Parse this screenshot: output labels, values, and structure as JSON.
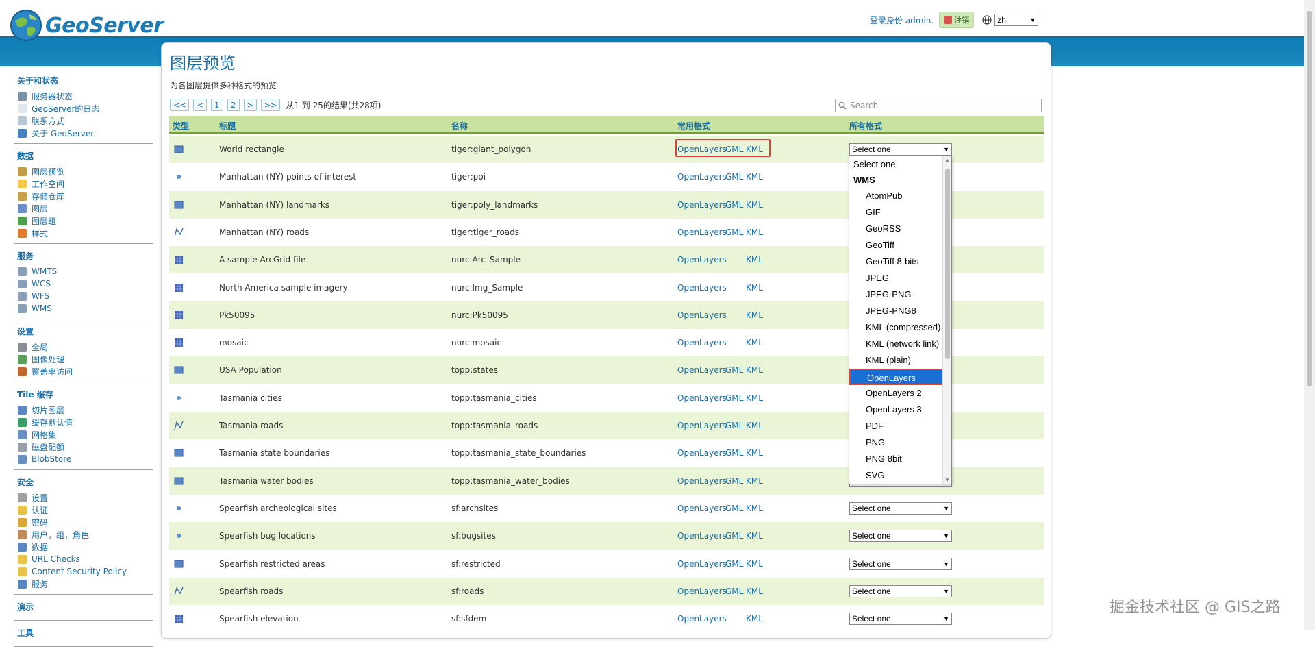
{
  "header": {
    "app_name": "GeoServer",
    "login_text": "登录身份 admin.",
    "logout_label": "注销",
    "lang_value": "zh"
  },
  "sidebar": {
    "sections": [
      {
        "title": "关于和状态",
        "items": [
          {
            "label": "服务器状态",
            "icon": "server-status-icon",
            "color": "#7a8fa8"
          },
          {
            "label": "GeoServer的日志",
            "icon": "log-icon",
            "color": "#dfe6ee"
          },
          {
            "label": "联系方式",
            "icon": "contact-icon",
            "color": "#b9c6d3"
          },
          {
            "label": "关于 GeoServer",
            "icon": "info-icon",
            "color": "#4a7fc0"
          }
        ]
      },
      {
        "title": "数据",
        "items": [
          {
            "label": "图层预览",
            "icon": "layer-preview-icon",
            "color": "#c59d4a"
          },
          {
            "label": "工作空间",
            "icon": "folder-icon",
            "color": "#f2c94c"
          },
          {
            "label": "存储仓库",
            "icon": "store-icon",
            "color": "#c9a04a"
          },
          {
            "label": "图层",
            "icon": "layer-icon",
            "color": "#6b8fc7"
          },
          {
            "label": "图层组",
            "icon": "layer-group-icon",
            "color": "#4ca04a"
          },
          {
            "label": "样式",
            "icon": "style-icon",
            "color": "#e07a2e"
          }
        ]
      },
      {
        "title": "服务",
        "items": [
          {
            "label": "WMTS",
            "icon": "wmts-icon",
            "color": "#8aa0b8"
          },
          {
            "label": "WCS",
            "icon": "wcs-icon",
            "color": "#8aa0b8"
          },
          {
            "label": "WFS",
            "icon": "wfs-icon",
            "color": "#8aa0b8"
          },
          {
            "label": "WMS",
            "icon": "wms-icon",
            "color": "#8aa0b8"
          }
        ]
      },
      {
        "title": "设置",
        "items": [
          {
            "label": "全局",
            "icon": "global-settings-icon",
            "color": "#8a8f96"
          },
          {
            "label": "图像处理",
            "icon": "image-processing-icon",
            "color": "#5aa05a"
          },
          {
            "label": "覆盖率访问",
            "icon": "coverage-access-icon",
            "color": "#c0672e"
          }
        ]
      },
      {
        "title": "Tile 缓存",
        "items": [
          {
            "label": "切片图层",
            "icon": "tile-layers-icon",
            "color": "#5b86c4"
          },
          {
            "label": "缓存默认值",
            "icon": "cache-defaults-icon",
            "color": "#3aa06a"
          },
          {
            "label": "网格集",
            "icon": "gridset-icon",
            "color": "#6a8fc0"
          },
          {
            "label": "磁盘配额",
            "icon": "disk-quota-icon",
            "color": "#9aa0a8"
          },
          {
            "label": "BlobStore",
            "icon": "blobstore-icon",
            "color": "#6a8fc0"
          }
        ]
      },
      {
        "title": "安全",
        "items": [
          {
            "label": "设置",
            "icon": "key-icon",
            "color": "#a0a0a0"
          },
          {
            "label": "认证",
            "icon": "shield-icon",
            "color": "#e8c44a"
          },
          {
            "label": "密码",
            "icon": "lock-icon",
            "color": "#d9a63a"
          },
          {
            "label": "用户，组，角色",
            "icon": "users-icon",
            "color": "#c08a5a"
          },
          {
            "label": "数据",
            "icon": "data-security-icon",
            "color": "#5a86c0"
          },
          {
            "label": "URL Checks",
            "icon": "url-check-icon",
            "color": "#e8c44a"
          },
          {
            "label": "Content Security Policy",
            "icon": "csp-icon",
            "color": "#e8c44a"
          },
          {
            "label": "服务",
            "icon": "service-security-icon",
            "color": "#5a86c0"
          }
        ]
      },
      {
        "title": "演示",
        "items": []
      },
      {
        "title": "工具",
        "items": []
      }
    ]
  },
  "main": {
    "title": "图层预览",
    "description": "为各图层提供多种格式的预览",
    "pager": {
      "first": "<<",
      "prev": "<",
      "pages": [
        "1",
        "2"
      ],
      "next": ">",
      "last": ">>",
      "summary": "从1 到 25的结果(共28项)"
    },
    "search_placeholder": "Search",
    "columns": {
      "type": "类型",
      "title": "标题",
      "name": "名称",
      "common": "常用格式",
      "all": "所有格式"
    },
    "format_links": {
      "openlayers": "OpenLayers",
      "gml": "GML",
      "kml": "KML"
    },
    "select_default": "Select one",
    "rows": [
      {
        "type": "polygon",
        "title": "World rectangle",
        "name": "tiger:giant_polygon",
        "gml": true
      },
      {
        "type": "point",
        "title": "Manhattan (NY) points of interest",
        "name": "tiger:poi",
        "gml": true
      },
      {
        "type": "polygon",
        "title": "Manhattan (NY) landmarks",
        "name": "tiger:poly_landmarks",
        "gml": true
      },
      {
        "type": "line",
        "title": "Manhattan (NY) roads",
        "name": "tiger:tiger_roads",
        "gml": true
      },
      {
        "type": "raster",
        "title": "A sample ArcGrid file",
        "name": "nurc:Arc_Sample",
        "gml": false
      },
      {
        "type": "raster",
        "title": "North America sample imagery",
        "name": "nurc:Img_Sample",
        "gml": false
      },
      {
        "type": "raster",
        "title": "Pk50095",
        "name": "nurc:Pk50095",
        "gml": false
      },
      {
        "type": "raster",
        "title": "mosaic",
        "name": "nurc:mosaic",
        "gml": false
      },
      {
        "type": "polygon",
        "title": "USA Population",
        "name": "topp:states",
        "gml": true
      },
      {
        "type": "point",
        "title": "Tasmania cities",
        "name": "topp:tasmania_cities",
        "gml": true
      },
      {
        "type": "line",
        "title": "Tasmania roads",
        "name": "topp:tasmania_roads",
        "gml": true
      },
      {
        "type": "polygon",
        "title": "Tasmania state boundaries",
        "name": "topp:tasmania_state_boundaries",
        "gml": true
      },
      {
        "type": "polygon",
        "title": "Tasmania water bodies",
        "name": "topp:tasmania_water_bodies",
        "gml": true
      },
      {
        "type": "point",
        "title": "Spearfish archeological sites",
        "name": "sf:archsites",
        "gml": true
      },
      {
        "type": "point",
        "title": "Spearfish bug locations",
        "name": "sf:bugsites",
        "gml": true
      },
      {
        "type": "polygon",
        "title": "Spearfish restricted areas",
        "name": "sf:restricted",
        "gml": true
      },
      {
        "type": "line",
        "title": "Spearfish roads",
        "name": "sf:roads",
        "gml": true
      },
      {
        "type": "raster",
        "title": "Spearfish elevation",
        "name": "sf:sfdem",
        "gml": false
      }
    ],
    "dropdown": {
      "options_before": [
        "Select one"
      ],
      "group": "WMS",
      "options": [
        "AtomPub",
        "GIF",
        "GeoRSS",
        "GeoTiff",
        "GeoTiff 8-bits",
        "JPEG",
        "JPEG-PNG",
        "JPEG-PNG8",
        "KML (compressed)",
        "KML (network link)",
        "KML (plain)",
        "OpenLayers",
        "OpenLayers 2",
        "OpenLayers 3",
        "PDF",
        "PNG",
        "PNG 8bit",
        "SVG"
      ],
      "selected": "OpenLayers"
    }
  },
  "watermark": "掘金技术社区 @ GIS之路",
  "colors": {
    "accent": "#1a6fa8",
    "header_band": "#1683ba",
    "row_alt": "#eaf4d6",
    "table_header": "#c8e2a0",
    "highlight": "#e0403a",
    "selected_option": "#1a6fd6"
  }
}
